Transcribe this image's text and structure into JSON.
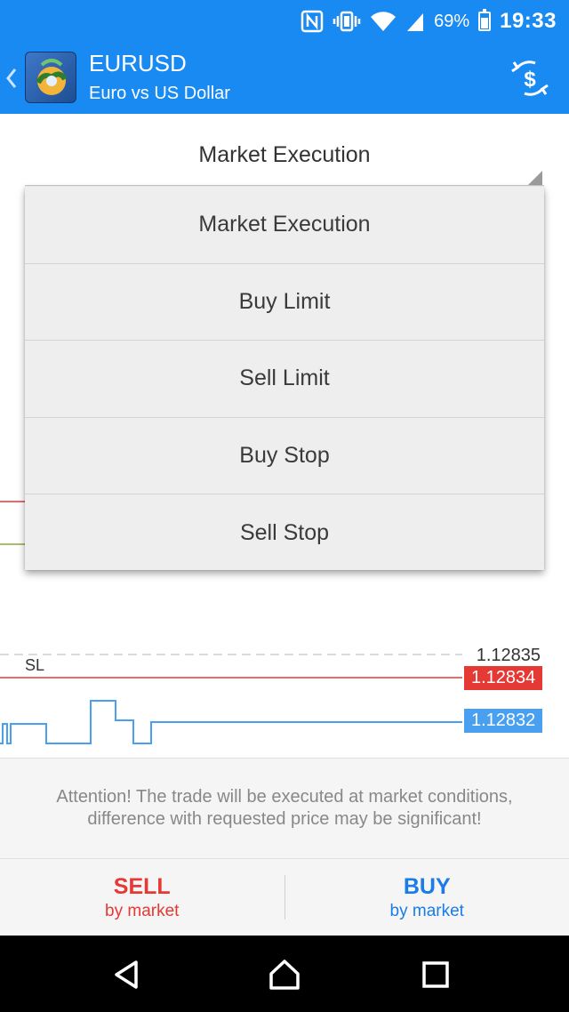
{
  "status_bar": {
    "battery_pct": "69%",
    "battery_level": 0.69,
    "time": "19:33",
    "icons": [
      "nfc-icon",
      "vibrate-icon",
      "wifi-icon",
      "signal-icon",
      "battery-icon"
    ]
  },
  "app_bar": {
    "symbol": "EURUSD",
    "description": "Euro vs US Dollar",
    "color": "#1a8af3"
  },
  "order": {
    "selected_type": "Market Execution",
    "options": [
      "Market Execution",
      "Buy Limit",
      "Sell Limit",
      "Buy Stop",
      "Sell Stop"
    ]
  },
  "chart": {
    "ask_price": "1.12835",
    "sl_label": "SL",
    "sl_price": "1.12834",
    "bid_price": "1.12832",
    "sl_color": "#e53935",
    "bid_color": "#4aa0f0"
  },
  "attention": {
    "message": "Attention! The trade will be executed at market conditions, difference with requested price may be significant!"
  },
  "actions": {
    "sell_label": "SELL",
    "sell_sub": "by market",
    "buy_label": "BUY",
    "buy_sub": "by market"
  }
}
